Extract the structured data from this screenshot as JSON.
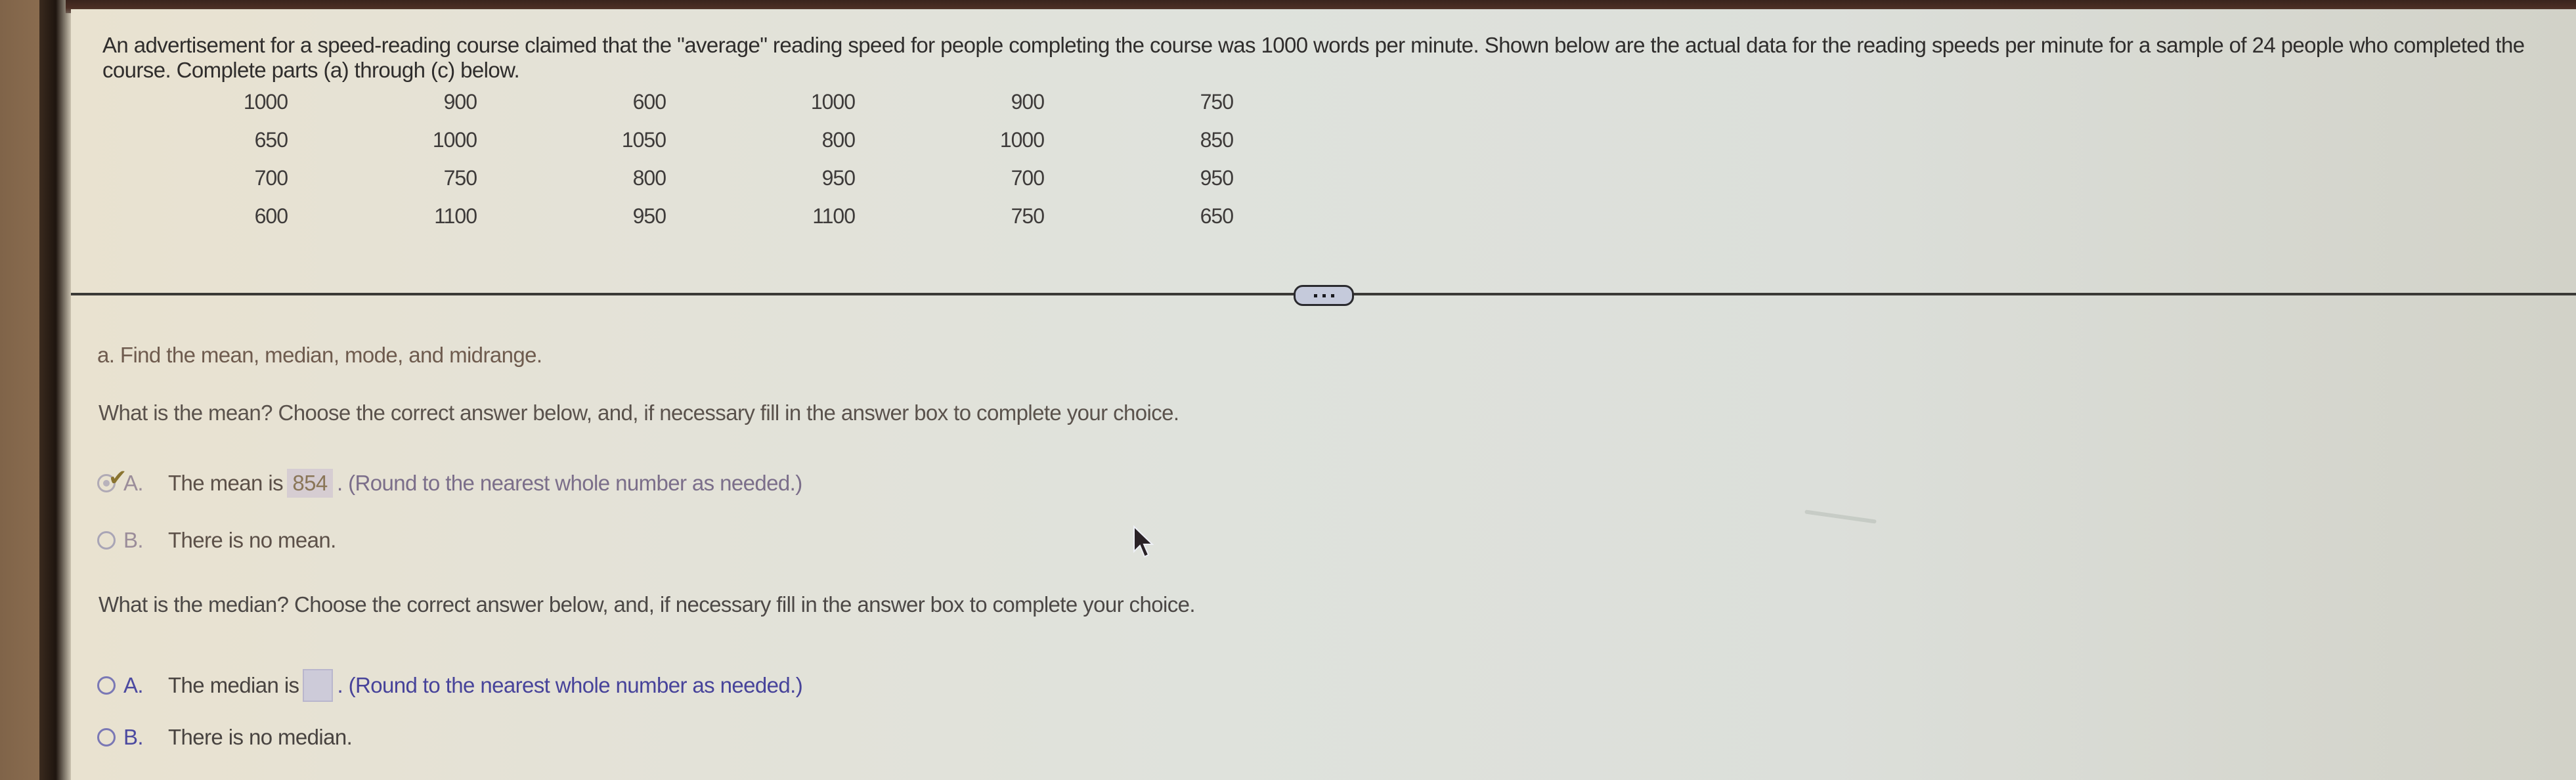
{
  "problem": {
    "intro_text": "An advertisement for a speed-reading course claimed that the \"average\" reading speed for people completing the course was 1000 words per minute. Shown below are the actual data for the reading speeds per minute for a sample of 24 people who completed the course. Complete parts (a) through (c) below.",
    "data_rows": [
      [
        "1000",
        "900",
        "600",
        "1000",
        "900",
        "750"
      ],
      [
        "650",
        "1000",
        "1050",
        "800",
        "1000",
        "850"
      ],
      [
        "700",
        "750",
        "800",
        "950",
        "700",
        "950"
      ],
      [
        "600",
        "1100",
        "950",
        "1100",
        "750",
        "650"
      ]
    ],
    "more_button_icon": "ellipsis-icon"
  },
  "part_a": {
    "label": "a. Find the mean, median, mode, and midrange.",
    "mean_question": "What is the mean? Choose the correct answer below, and, if necessary fill in the answer box to complete your choice.",
    "mean_options": [
      {
        "letter": "A.",
        "text_before": "The mean is",
        "answer_value": "854",
        "text_after": ". (Round to the nearest whole number as needed.)",
        "selected": true,
        "status": "correct"
      },
      {
        "letter": "B.",
        "text": "There is no mean.",
        "selected": false
      }
    ],
    "median_question": "What is the median? Choose the correct answer below, and, if necessary fill in the answer box to complete your choice.",
    "median_options": [
      {
        "letter": "A.",
        "text_before": "The median is",
        "answer_value": "",
        "text_after": ". (Round to the nearest whole number as needed.)",
        "selected": false
      },
      {
        "letter": "B.",
        "text": "There is no median.",
        "selected": false
      }
    ]
  },
  "colors": {
    "hint_text": "#47439a",
    "correct_check": "#8a7430",
    "answer_box_fill": "#d6cdd2"
  }
}
